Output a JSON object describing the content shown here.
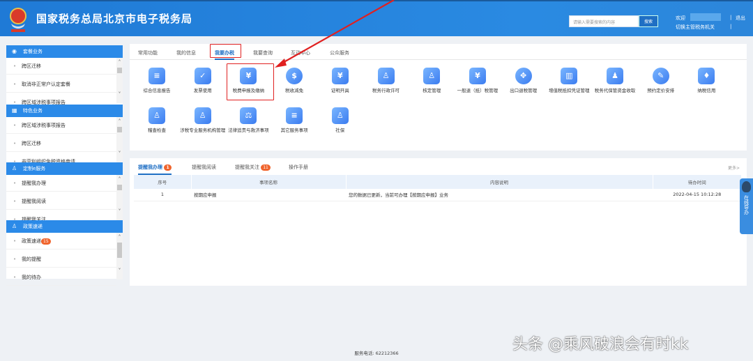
{
  "header": {
    "title": "国家税务总局北京市电子税务局",
    "search_placeholder": "请输入需要搜索的内容",
    "search_button": "搜索",
    "welcome": "欢迎",
    "switch_office": "切换主管税务机关",
    "logout": "退出",
    "separator": "|"
  },
  "sidebar": [
    {
      "title": "套餐业务",
      "icon": "cube-icon",
      "items": [
        "跨区迁移",
        "取消非正常户认定套餐",
        "跨区域涉税事项报告"
      ]
    },
    {
      "title": "特色业务",
      "icon": "grid-icon",
      "items": [
        "跨区域涉税事项报告",
        "跨区迁移",
        "非营利组织免税资格申请"
      ]
    },
    {
      "title": "定制e服务",
      "icon": "user-icon",
      "items": [
        "提醒我办理",
        "提醒我阅读",
        "提醒我关注"
      ]
    },
    {
      "title": "政策速递",
      "icon": "user-icon",
      "items": [
        "政策速递",
        "我的提醒",
        "我的待办"
      ],
      "badge": "15"
    }
  ],
  "tabs": [
    "常用功能",
    "我的信息",
    "我要办税",
    "我要查询",
    "互动中心",
    "公众服务"
  ],
  "active_tab": "我要办税",
  "services_row1": [
    "综合信息报告",
    "发票使用",
    "税费申报及缴纳",
    "税收减免",
    "证明开具",
    "税务行政许可",
    "核定管理",
    "一般退（抵）税管理",
    "出口退税管理",
    "增值税抵扣凭证管理",
    "税务代保管资金收取",
    "预约定价安排",
    "纳税信用"
  ],
  "services_row2": [
    "稽查检查",
    "涉税专业服务机构管理",
    "法律追责与救济事项",
    "其它服务事项",
    "社保"
  ],
  "reminders": {
    "tabs": [
      {
        "label": "提醒我办理",
        "badge": "1"
      },
      {
        "label": "提醒我阅读"
      },
      {
        "label": "提醒我关注",
        "badge": "11"
      },
      {
        "label": "操作手册"
      }
    ],
    "more": "更多>",
    "columns": [
      "序号",
      "事项名称",
      "内容说明",
      "待办时间"
    ],
    "rows": [
      [
        "1",
        "按期应申报",
        "您的数据已更新，当前可办理【按期应申报】业务",
        "2022-04-15 10:12:28"
      ]
    ]
  },
  "help": "在线导办",
  "footer": "服务电话: 62212366",
  "watermark": "头条 @乘风破浪会有时kk",
  "colors": {
    "header": "#1f7ad6",
    "accent": "#2b8ae8",
    "annotation": "#e02020",
    "badge": "#f0642d"
  }
}
